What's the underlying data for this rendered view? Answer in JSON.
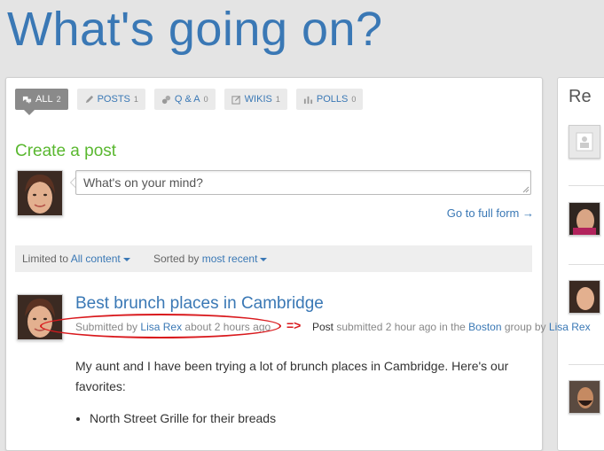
{
  "page": {
    "title": "What's going on?"
  },
  "filters": [
    {
      "label": "ALL",
      "count": "2",
      "icon": "speech-bubbles-icon",
      "active": true
    },
    {
      "label": "POSTS",
      "count": "1",
      "icon": "pencil-icon"
    },
    {
      "label": "Q & A",
      "count": "0",
      "icon": "qa-bubbles-icon"
    },
    {
      "label": "WIKIS",
      "count": "1",
      "icon": "edit-page-icon"
    },
    {
      "label": "POLLS",
      "count": "0",
      "icon": "bar-chart-icon"
    }
  ],
  "create": {
    "title": "Create a post",
    "placeholder": "What's on your mind?",
    "full_form_link": "Go to full form →"
  },
  "sortbar": {
    "limited_prefix": "Limited to",
    "limited_value": "All content",
    "sorted_prefix": "Sorted by",
    "sorted_value": "most recent"
  },
  "post": {
    "title": "Best brunch places in Cambridge",
    "meta_prefix": "Submitted by",
    "author": "Lisa Rex",
    "meta_suffix": "about 2 hours ago",
    "body": "My aunt and I have been trying a lot of brunch places in Cambridge. Here's our favorites:",
    "list": [
      "North Street Grille for their breads"
    ]
  },
  "annotation": {
    "arrow": "=>",
    "type_word": "Post",
    "text1": "submitted 2 hour ago in the",
    "group": "Boston",
    "text2": "group by",
    "user": "Lisa Rex",
    "color": "#d9191d"
  },
  "right_panel": {
    "title_partial": "Re"
  },
  "colors": {
    "link": "#3a78b5",
    "create_green": "#5ab830",
    "title_blue": "#3a78b5"
  }
}
